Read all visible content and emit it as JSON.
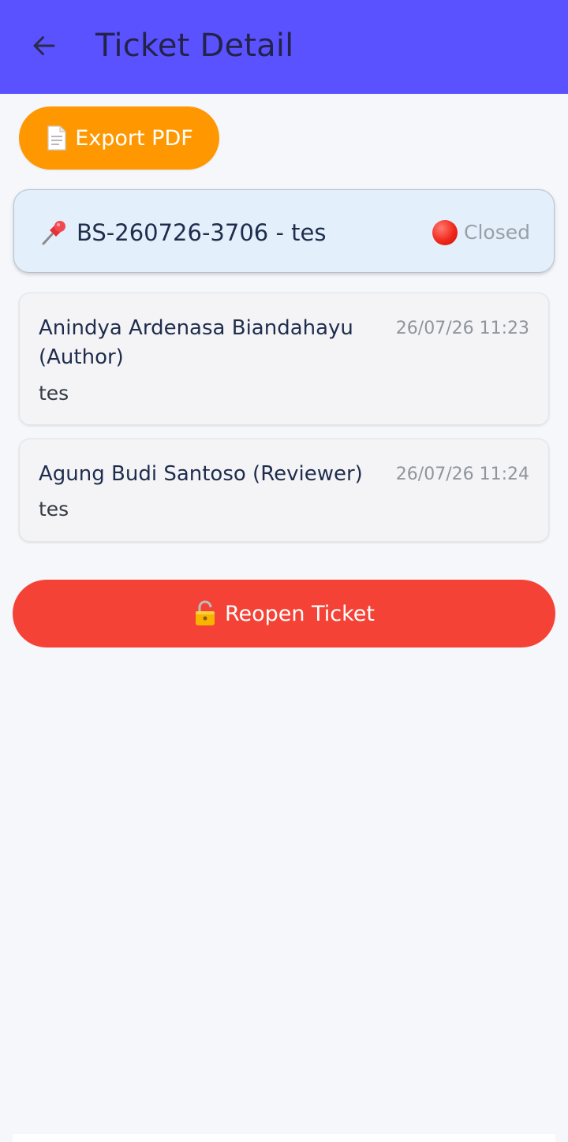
{
  "appbar": {
    "title": "Ticket Detail",
    "back_icon": "arrow-left-icon",
    "background": "#5a52ff"
  },
  "actions": {
    "export_label": "Export PDF",
    "export_icon": "document-icon",
    "export_color": "#ff9800"
  },
  "ticket": {
    "pin_icon": "pushpin-icon",
    "title": "BS-260726-3706 - tes",
    "status": "Closed",
    "status_icon": "red-circle-icon"
  },
  "comments": [
    {
      "author": "Anindya Ardenasa Biandahayu (Author)",
      "time": "26/07/26 11:23",
      "text": "tes"
    },
    {
      "author": "Agung Budi Santoso (Reviewer)",
      "time": "26/07/26 11:24",
      "text": "tes"
    }
  ],
  "reopen": {
    "label": "Reopen Ticket",
    "icon": "unlock-icon",
    "color": "#f44336"
  }
}
